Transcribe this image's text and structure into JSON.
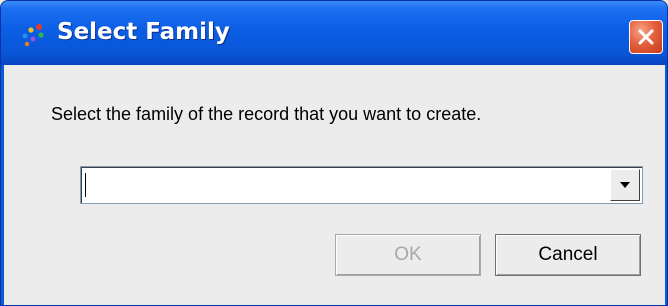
{
  "window": {
    "title": "Select Family",
    "icon": "colored-dots-icon",
    "close_icon": "close-x-icon"
  },
  "content": {
    "prompt": "Select the family of the record that you want to create."
  },
  "family_select": {
    "value": "",
    "dropdown_icon": "chevron-down-icon"
  },
  "buttons": {
    "ok_label": "OK",
    "ok_enabled": false,
    "cancel_label": "Cancel"
  },
  "colors": {
    "titlebar": "#0a5bd6",
    "close_button": "#d9532f",
    "dialog_background": "#ececec",
    "disabled_text": "#a8a8a8"
  }
}
